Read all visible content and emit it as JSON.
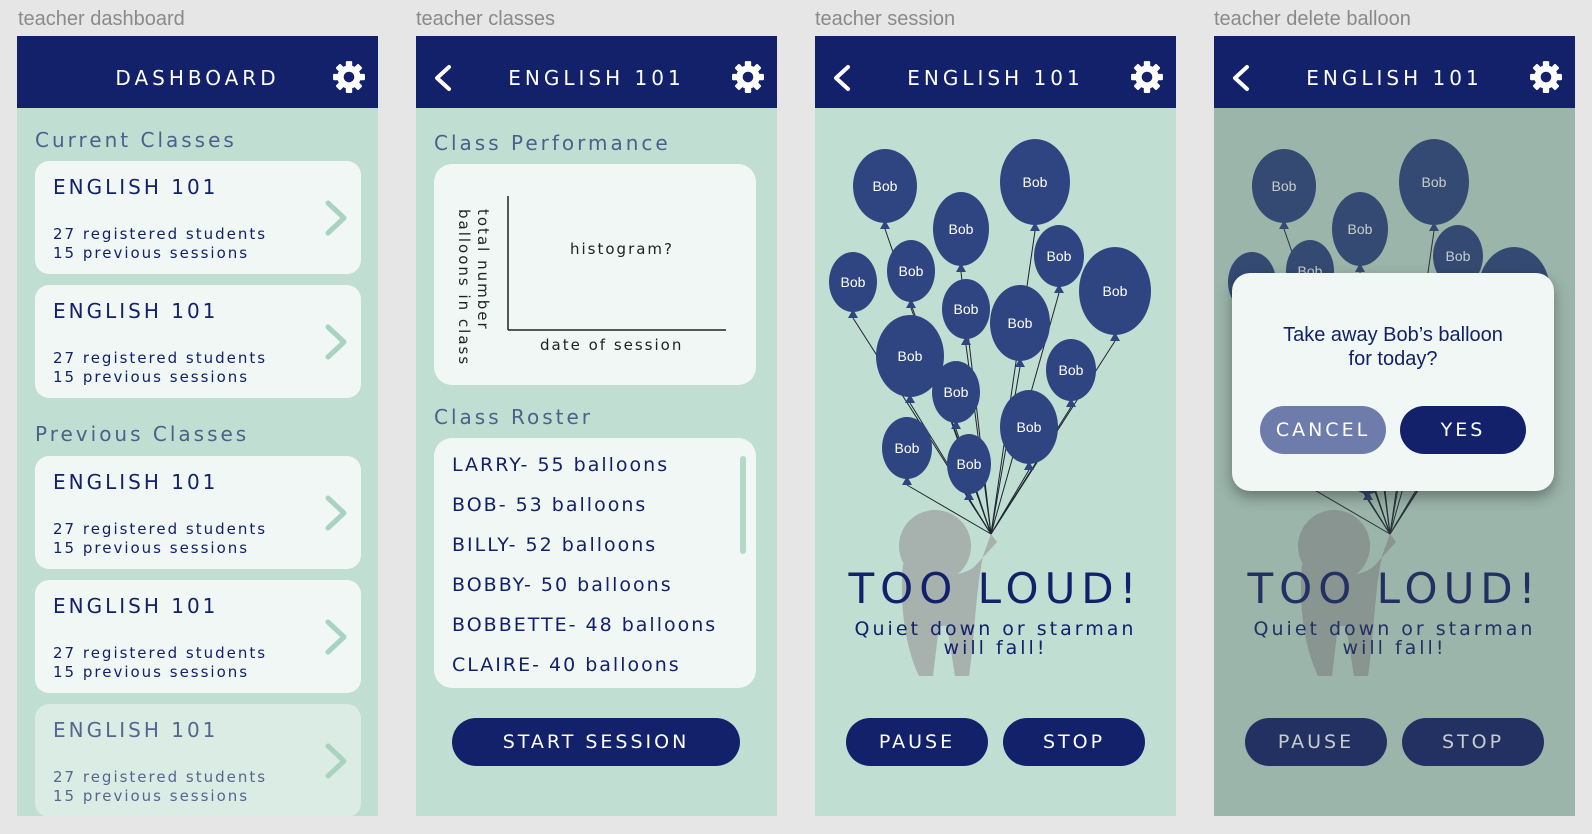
{
  "frame_labels": {
    "dashboard": "teacher dashboard",
    "classes": "teacher classes",
    "session": "teacher session",
    "delete": "teacher delete balloon"
  },
  "colors": {
    "navy": "#13216b",
    "mint": "#c0ded1",
    "card": "#f0f7f4",
    "balloon": "#2f4581",
    "cancel": "#6e7cab"
  },
  "icons": {
    "settings": "gear-icon",
    "back": "back-arrow-icon",
    "open_class": "chevron-right-icon"
  },
  "dashboard": {
    "title": "DASHBOARD",
    "current_heading": "Current Classes",
    "previous_heading": "Previous Classes",
    "current_classes": [
      {
        "name": "ENGLISH 101",
        "students": "27 registered students",
        "sessions": "15 previous sessions"
      },
      {
        "name": "ENGLISH 101",
        "students": "27 registered students",
        "sessions": "15 previous sessions"
      }
    ],
    "previous_classes": [
      {
        "name": "ENGLISH 101",
        "students": "27 registered students",
        "sessions": "15 previous sessions"
      },
      {
        "name": "ENGLISH 101",
        "students": "27 registered students",
        "sessions": "15 previous sessions"
      },
      {
        "name": "ENGLISH 101",
        "students": "27 registered students",
        "sessions": "15 previous sessions"
      }
    ]
  },
  "classes": {
    "title": "ENGLISH 101",
    "performance_heading": "Class Performance",
    "chart": {
      "placeholder": "histogram?",
      "xlabel": "date of session",
      "ylabel_line1": "total number",
      "ylabel_line2": "balloons in class"
    },
    "roster_heading": "Class Roster",
    "roster": [
      "LARRY- 55 balloons",
      "BOB- 53 balloons",
      "BILLY- 52 balloons",
      "BOBBY- 50 balloons",
      "BOBBETTE- 48 balloons",
      "CLAIRE- 40 balloons"
    ],
    "start_label": "START SESSION"
  },
  "session": {
    "title": "ENGLISH 101",
    "balloon_label": "Bob",
    "alert_title": "TOO LOUD!",
    "alert_line1": "Quiet down or starman",
    "alert_line2": "will fall!",
    "pause_label": "PAUSE",
    "stop_label": "STOP"
  },
  "delete": {
    "title": "ENGLISH 101",
    "dialog_line1": "Take away Bob’s balloon",
    "dialog_line2": "for today?",
    "cancel_label": "CANCEL",
    "yes_label": "YES"
  }
}
